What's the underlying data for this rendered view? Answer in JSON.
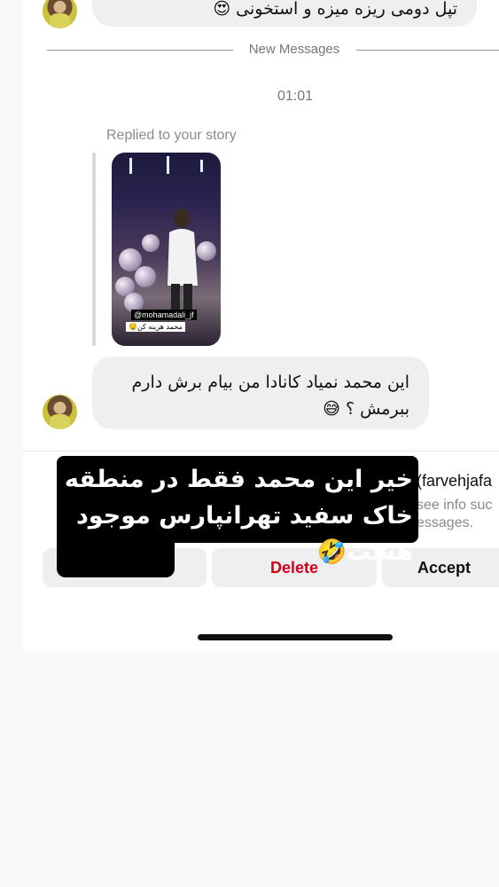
{
  "messages": {
    "prev_message": "تپل دومی ریزه میزه و استخونی 😍",
    "divider": "New Messages",
    "time": "01:01",
    "replied_label": "Replied to your story",
    "story": {
      "mention": "@mohamadali_jf",
      "caption": "محمد هزینه کن🤤"
    },
    "reply_message_line1": "این محمد نمیاد کانادا من بیام برش دارم",
    "reply_message_line2": "ببرمش ؟ 😅"
  },
  "request": {
    "name_partial": "(farvehjafa",
    "info_line": "see info suc",
    "info_line2": "essages."
  },
  "buttons": {
    "delete": "Delete",
    "accept": "Accept"
  },
  "overlay": {
    "text": "خیر این محمد فقط در منطقه خاک سفید تهرانپارس موجود هست🤣"
  },
  "colors": {
    "delete": "#d0021b",
    "bubble": "#efefef",
    "overlay": "#000000"
  }
}
